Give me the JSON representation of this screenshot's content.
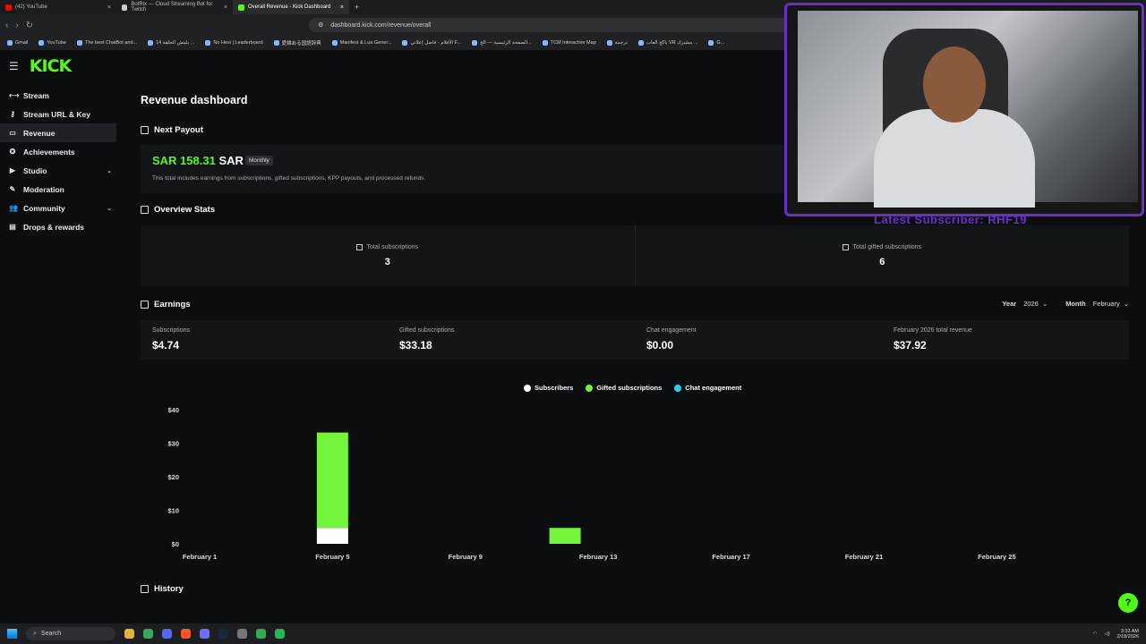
{
  "browser": {
    "tabs": [
      {
        "label": "(42) YouTube",
        "color": "#ff0000"
      },
      {
        "label": "BotRix — Cloud Streaming Bot for Twitch",
        "color": "#cccccc"
      },
      {
        "label": "Overall Revenue - Kick Dashboard",
        "color": "#53fc18"
      }
    ],
    "new_tab": "+",
    "url": "dashboard.kick.com/revenue/overall",
    "bookmarks": [
      "Gmail",
      "YouTube",
      "The best ChatBot and...",
      "بليتش الحلقة 14 ...",
      "No Hesi | Leaderboard",
      "愛嬌ある国語辞典",
      "Manifest & Lua Gener...",
      "الأفلام - فاصل إعلاني F...",
      "الصفحة الرئيسية — الج...",
      "TCM Interactive Map",
      "ترجمة",
      "باكج العاب VR مشترك ...",
      "G..."
    ]
  },
  "app": {
    "logo": "KICK",
    "sidebar": [
      {
        "label": "Stream",
        "icon": "stream-icon",
        "glyph": "⟷",
        "chev": ""
      },
      {
        "label": "Stream URL & Key",
        "icon": "link-icon",
        "glyph": "⚷",
        "chev": ""
      },
      {
        "label": "Revenue",
        "icon": "revenue-icon",
        "glyph": "▭",
        "chev": ""
      },
      {
        "label": "Achievements",
        "icon": "achievements-icon",
        "glyph": "✪",
        "chev": ""
      },
      {
        "label": "Studio",
        "icon": "studio-icon",
        "glyph": "▶",
        "chev": "⌄"
      },
      {
        "label": "Moderation",
        "icon": "moderation-icon",
        "glyph": "✎",
        "chev": ""
      },
      {
        "label": "Community",
        "icon": "community-icon",
        "glyph": "👥",
        "chev": "⌄"
      },
      {
        "label": "Drops & rewards",
        "icon": "drops-icon",
        "glyph": "▤",
        "chev": ""
      }
    ]
  },
  "page": {
    "title": "Revenue dashboard",
    "next_payout": {
      "heading": "Next Payout",
      "amount": "SAR 158.31",
      "currency": "SAR",
      "badge": "Monthly",
      "note": "This total includes earnings from subscriptions, gifted subscriptions, KPP payouts, and processed refunds."
    },
    "overview": {
      "heading": "Overview Stats",
      "total_subs_label": "Total subscriptions",
      "total_subs_value": "3",
      "total_gifted_label": "Total gifted subscriptions",
      "total_gifted_value": "6"
    },
    "earnings": {
      "heading": "Earnings",
      "year_label": "Year",
      "year_value": "2026",
      "month_label": "Month",
      "month_value": "February",
      "cards": [
        {
          "label": "Subscriptions",
          "value": "$4.74"
        },
        {
          "label": "Gifted subscriptions",
          "value": "$33.18"
        },
        {
          "label": "Chat engagement",
          "value": "$0.00"
        },
        {
          "label": "February 2026 total revenue",
          "value": "$37.92"
        }
      ]
    },
    "history_heading": "History"
  },
  "chart_data": {
    "type": "bar",
    "stacked": true,
    "ylim": [
      0,
      40
    ],
    "yticks": [
      "$0",
      "$10",
      "$20",
      "$30",
      "$40"
    ],
    "x_tick_labels": [
      "February 1",
      "February 5",
      "February 9",
      "February 13",
      "February 17",
      "February 21",
      "February 25"
    ],
    "series": [
      {
        "name": "Subscribers",
        "color": "#ffffff",
        "points": [
          {
            "x": "February 5",
            "value": 4.74
          }
        ]
      },
      {
        "name": "Gifted subscriptions",
        "color": "#72f53a",
        "points": [
          {
            "x": "February 5",
            "value": 28.44
          },
          {
            "x": "February 12",
            "value": 4.74
          }
        ]
      },
      {
        "name": "Chat engagement",
        "color": "#22d3ee",
        "points": []
      }
    ]
  },
  "overlay": {
    "caption": "Latest Subscriber: RHF19"
  },
  "taskbar": {
    "search": "Search",
    "time": "3:33 AM",
    "date": "2/18/2026"
  }
}
